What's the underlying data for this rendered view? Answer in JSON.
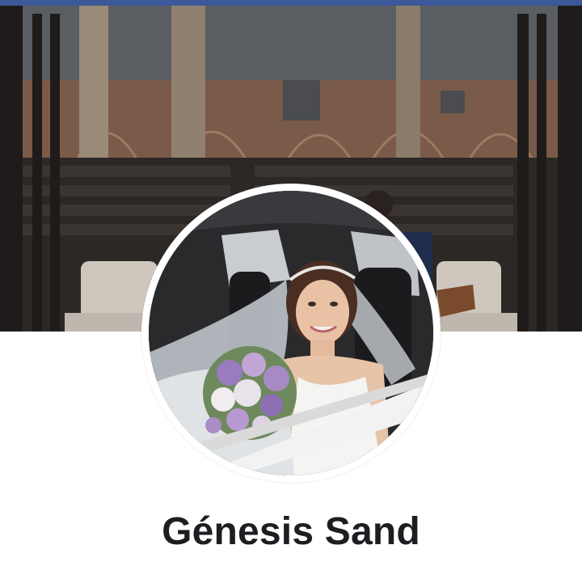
{
  "app": {
    "accent_color": "#3b5998"
  },
  "profile": {
    "name": "Génesis Sand",
    "cover_photo_icon": "cover-photo",
    "profile_photo_icon": "profile-photo"
  }
}
